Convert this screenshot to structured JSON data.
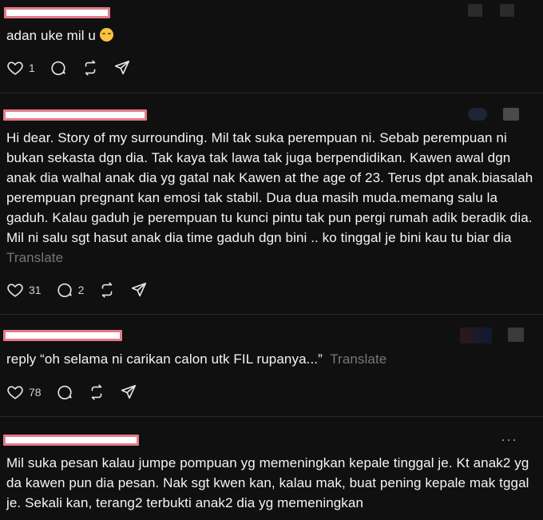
{
  "colors": {
    "background": "#101010",
    "text": "#f3f5f7",
    "muted": "#777777",
    "divider": "#2a2a2a",
    "redaction_fill": "#ffffff",
    "redaction_border": "#e47b86"
  },
  "posts": [
    {
      "text": "adan uke mil u",
      "emoji": "relieved-face-emoji",
      "likes": "1",
      "replies": "",
      "translate": ""
    },
    {
      "text": "Hi dear. Story of my surrounding. Mil tak suka perempuan ni. Sebab perempuan ni bukan sekasta dgn dia. Tak kaya tak lawa tak juga berpendidikan. Kawen awal dgn anak dia walhal anak dia yg gatal nak Kawen at the age of 23. Terus dpt anak.biasalah perempuan pregnant kan emosi tak stabil. Dua dua masih muda.memang salu la gaduh. Kalau gaduh je perempuan tu kunci pintu tak pun pergi rumah adik beradik dia. Mil ni salu sgt hasut anak dia time gaduh dgn bini .. ko tinggal je bini kau tu biar dia",
      "translate": "Translate",
      "likes": "31",
      "replies": "2"
    },
    {
      "text": "reply “oh selama ni carikan calon utk FIL rupanya...”",
      "translate": "Translate",
      "likes": "78",
      "replies": ""
    },
    {
      "text": "Mil suka pesan kalau jumpe pompuan yg memeningkan kepale tinggal je. Kt anak2 yg da kawen pun dia pesan. Nak sgt kwen kan, kalau mak, buat pening kepale mak tggal je. Sekali kan, terang2 terbukti anak2 dia yg memeningkan",
      "more": "···"
    }
  ],
  "icons": {
    "like": "heart-icon",
    "reply": "comment-icon",
    "repost": "repost-icon",
    "share": "share-icon",
    "more": "more-options-icon"
  }
}
